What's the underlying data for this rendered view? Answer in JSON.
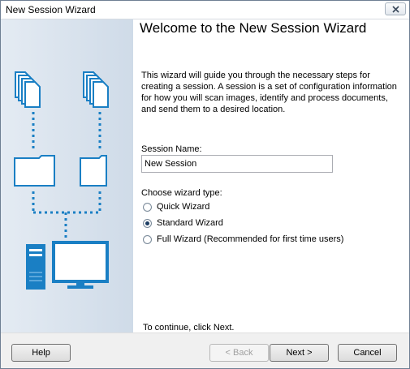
{
  "window": {
    "title": "New Session Wizard"
  },
  "page": {
    "heading": "Welcome to the New Session Wizard",
    "description": "This wizard will guide you through the necessary steps for creating a session. A session is a set of configuration information for how you will scan images, identify and process documents, and send them to a desired location.",
    "session_name_label": "Session Name:",
    "session_name_value": "New Session",
    "wizard_type_label": "Choose wizard type:",
    "wizard_types": [
      {
        "label": "Quick Wizard",
        "checked": false
      },
      {
        "label": "Standard Wizard",
        "checked": true
      },
      {
        "label": "Full Wizard (Recommended for first time users)",
        "checked": false
      }
    ],
    "continue_text": "To continue, click Next."
  },
  "buttons": {
    "help": "Help",
    "back": "< Back",
    "next": "Next >",
    "cancel": "Cancel"
  },
  "colors": {
    "illustration": "#1a7fc4",
    "sidebar": "#d8e2ee"
  }
}
